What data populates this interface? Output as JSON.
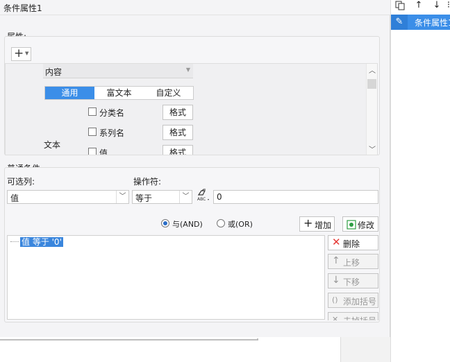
{
  "dialog": {
    "title": "条件属性1",
    "attributes_label": "属性:",
    "add_icon": "plus-icon",
    "content_dropdown": "内容",
    "tabs": [
      "通用",
      "富文本",
      "自定义"
    ],
    "checkboxes": [
      {
        "label": "分类名",
        "format_label": "格式",
        "checked": false
      },
      {
        "label": "系列名",
        "format_label": "格式",
        "checked": false
      },
      {
        "label": "值",
        "format_label": "格式",
        "checked": false
      }
    ],
    "text_label": "文本"
  },
  "conditions": {
    "group_label": "普通条件",
    "column_label": "可选列:",
    "operator_label": "操作符:",
    "column_value": "值",
    "operator_value": "等于",
    "value": "0",
    "formula_icon_text": "ABC",
    "radio_and": "与(AND)",
    "radio_or": "或(OR)",
    "add_label": "增加",
    "modify_label": "修改",
    "delete_label": "删除",
    "move_up_label": "上移",
    "move_down_label": "下移",
    "add_bracket_label": "添加括号",
    "remove_bracket_label": "去掉括号",
    "list_items": [
      "值 等于 '0'"
    ]
  },
  "right_panel": {
    "toolbar_icons": [
      "copy-icon",
      "move-up-icon",
      "move-down-icon",
      "more-icon"
    ],
    "items": [
      {
        "label": "条件属性1",
        "selected": true
      }
    ]
  },
  "colors": {
    "accent": "#3b8ee8",
    "delete_red": "#e53935",
    "modify_green": "#2e9e44"
  }
}
